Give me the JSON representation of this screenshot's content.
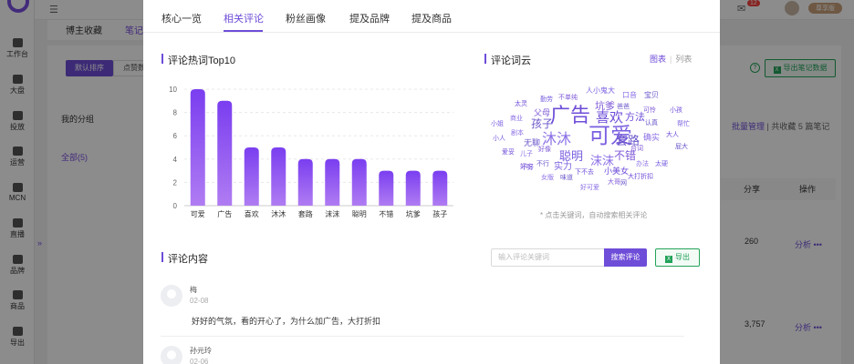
{
  "sidebar": {
    "items": [
      {
        "label": "工作台"
      },
      {
        "label": "大盘"
      },
      {
        "label": "投放"
      },
      {
        "label": "运营"
      },
      {
        "label": "MCN"
      },
      {
        "label": "直播"
      },
      {
        "label": "品牌"
      },
      {
        "label": "商品"
      },
      {
        "label": "导出"
      }
    ]
  },
  "topbar": {
    "notification_count": "12",
    "vip_label": "尊享版"
  },
  "background": {
    "tab_blogger": "博主收藏",
    "tab_notes": "笔记",
    "sort_default": "默认排序",
    "sort_likes": "点赞数",
    "my_groups": "我的分组",
    "all_groups": "全部(5)",
    "export_notes": "导出笔记数据",
    "batch_manage": "批量管理",
    "batch_summary": "| 共收藏 5 篇笔记",
    "col_share": "分享",
    "col_action": "操作",
    "rows": [
      {
        "share": "260",
        "action": "分析 •••"
      },
      {
        "share": "3,757",
        "action": "分析 •••"
      }
    ]
  },
  "modal": {
    "tabs": [
      {
        "label": "核心一览",
        "active": false
      },
      {
        "label": "相关评论",
        "active": true
      },
      {
        "label": "粉丝画像",
        "active": false
      },
      {
        "label": "提及品牌",
        "active": false
      },
      {
        "label": "提及商品",
        "active": false
      }
    ],
    "hot_words_title": "评论热词Top10",
    "word_cloud_title": "评论词云",
    "view_chart": "图表",
    "view_list": "列表",
    "word_cloud_hint": "* 点击关键词，自动搜索相关评论",
    "comments_title": "评论内容",
    "search_placeholder": "输入评论关键词",
    "search_button": "搜索评论",
    "export_button": "导出",
    "accent_color": "#6e4dd8",
    "comments": [
      {
        "name": "梅",
        "date": "02-08",
        "text": "好好的气氛，看的开心了，为什么加广告，大打折扣"
      },
      {
        "name": "孙元玲",
        "date": "02-06",
        "text": ""
      }
    ]
  },
  "word_cloud": [
    {
      "text": "广告",
      "size": 22
    },
    {
      "text": "可爱",
      "size": 24
    },
    {
      "text": "沐沐",
      "size": 16
    },
    {
      "text": "套路",
      "size": 13
    },
    {
      "text": "坑爹",
      "size": 11
    },
    {
      "text": "喜欢",
      "size": 15
    },
    {
      "text": "聪明",
      "size": 13
    },
    {
      "text": "沫沫",
      "size": 13
    },
    {
      "text": "孩子",
      "size": 12
    },
    {
      "text": "不错",
      "size": 12
    },
    {
      "text": "方法",
      "size": 11
    },
    {
      "text": "实力",
      "size": 10
    },
    {
      "text": "确实",
      "size": 9
    },
    {
      "text": "无聊",
      "size": 9
    },
    {
      "text": "父母",
      "size": 9
    },
    {
      "text": "小美女",
      "size": 9
    },
    {
      "text": "人小鬼大",
      "size": 8
    },
    {
      "text": "口音",
      "size": 8
    },
    {
      "text": "宝贝",
      "size": 8
    },
    {
      "text": "不单纯",
      "size": 7
    },
    {
      "text": "太灵",
      "size": 7
    },
    {
      "text": "勤劳",
      "size": 7
    },
    {
      "text": "商业",
      "size": 7
    },
    {
      "text": "爸爸",
      "size": 7
    },
    {
      "text": "可怜",
      "size": 7
    },
    {
      "text": "小孩",
      "size": 7
    },
    {
      "text": "小姐",
      "size": 7
    },
    {
      "text": "剧本",
      "size": 7
    },
    {
      "text": "认真",
      "size": 7
    },
    {
      "text": "好像",
      "size": 7
    },
    {
      "text": "大人",
      "size": 7
    },
    {
      "text": "小人",
      "size": 7
    },
    {
      "text": "儿子",
      "size": 7
    },
    {
      "text": "不行",
      "size": 7
    },
    {
      "text": "台词",
      "size": 7
    },
    {
      "text": "爱妥",
      "size": 7
    },
    {
      "text": "不好",
      "size": 7
    },
    {
      "text": "办法",
      "size": 7
    },
    {
      "text": "屁大",
      "size": 7
    },
    {
      "text": "好吃",
      "size": 7
    },
    {
      "text": "下不去",
      "size": 7
    },
    {
      "text": "太硬",
      "size": 7
    },
    {
      "text": "女版",
      "size": 7
    },
    {
      "text": "味道",
      "size": 7
    },
    {
      "text": "大哥",
      "size": 7
    },
    {
      "text": "大打折扣",
      "size": 7
    },
    {
      "text": "帮忙",
      "size": 7
    },
    {
      "text": "好可爱",
      "size": 7
    },
    {
      "text": "网",
      "size": 7
    }
  ],
  "chart_data": {
    "type": "bar",
    "title": "评论热词Top10",
    "categories": [
      "可爱",
      "广告",
      "喜欢",
      "沐沐",
      "套路",
      "沫沫",
      "聪明",
      "不错",
      "坑爹",
      "孩子"
    ],
    "values": [
      10,
      9,
      5,
      5,
      4,
      4,
      4,
      3,
      3,
      3
    ],
    "ylim": [
      0,
      10
    ],
    "yticks": [
      "0",
      "2",
      "4",
      "6",
      "8",
      "10"
    ],
    "grid": true,
    "bar_gradient": [
      "#7a3ef0",
      "#b07cf2"
    ]
  }
}
